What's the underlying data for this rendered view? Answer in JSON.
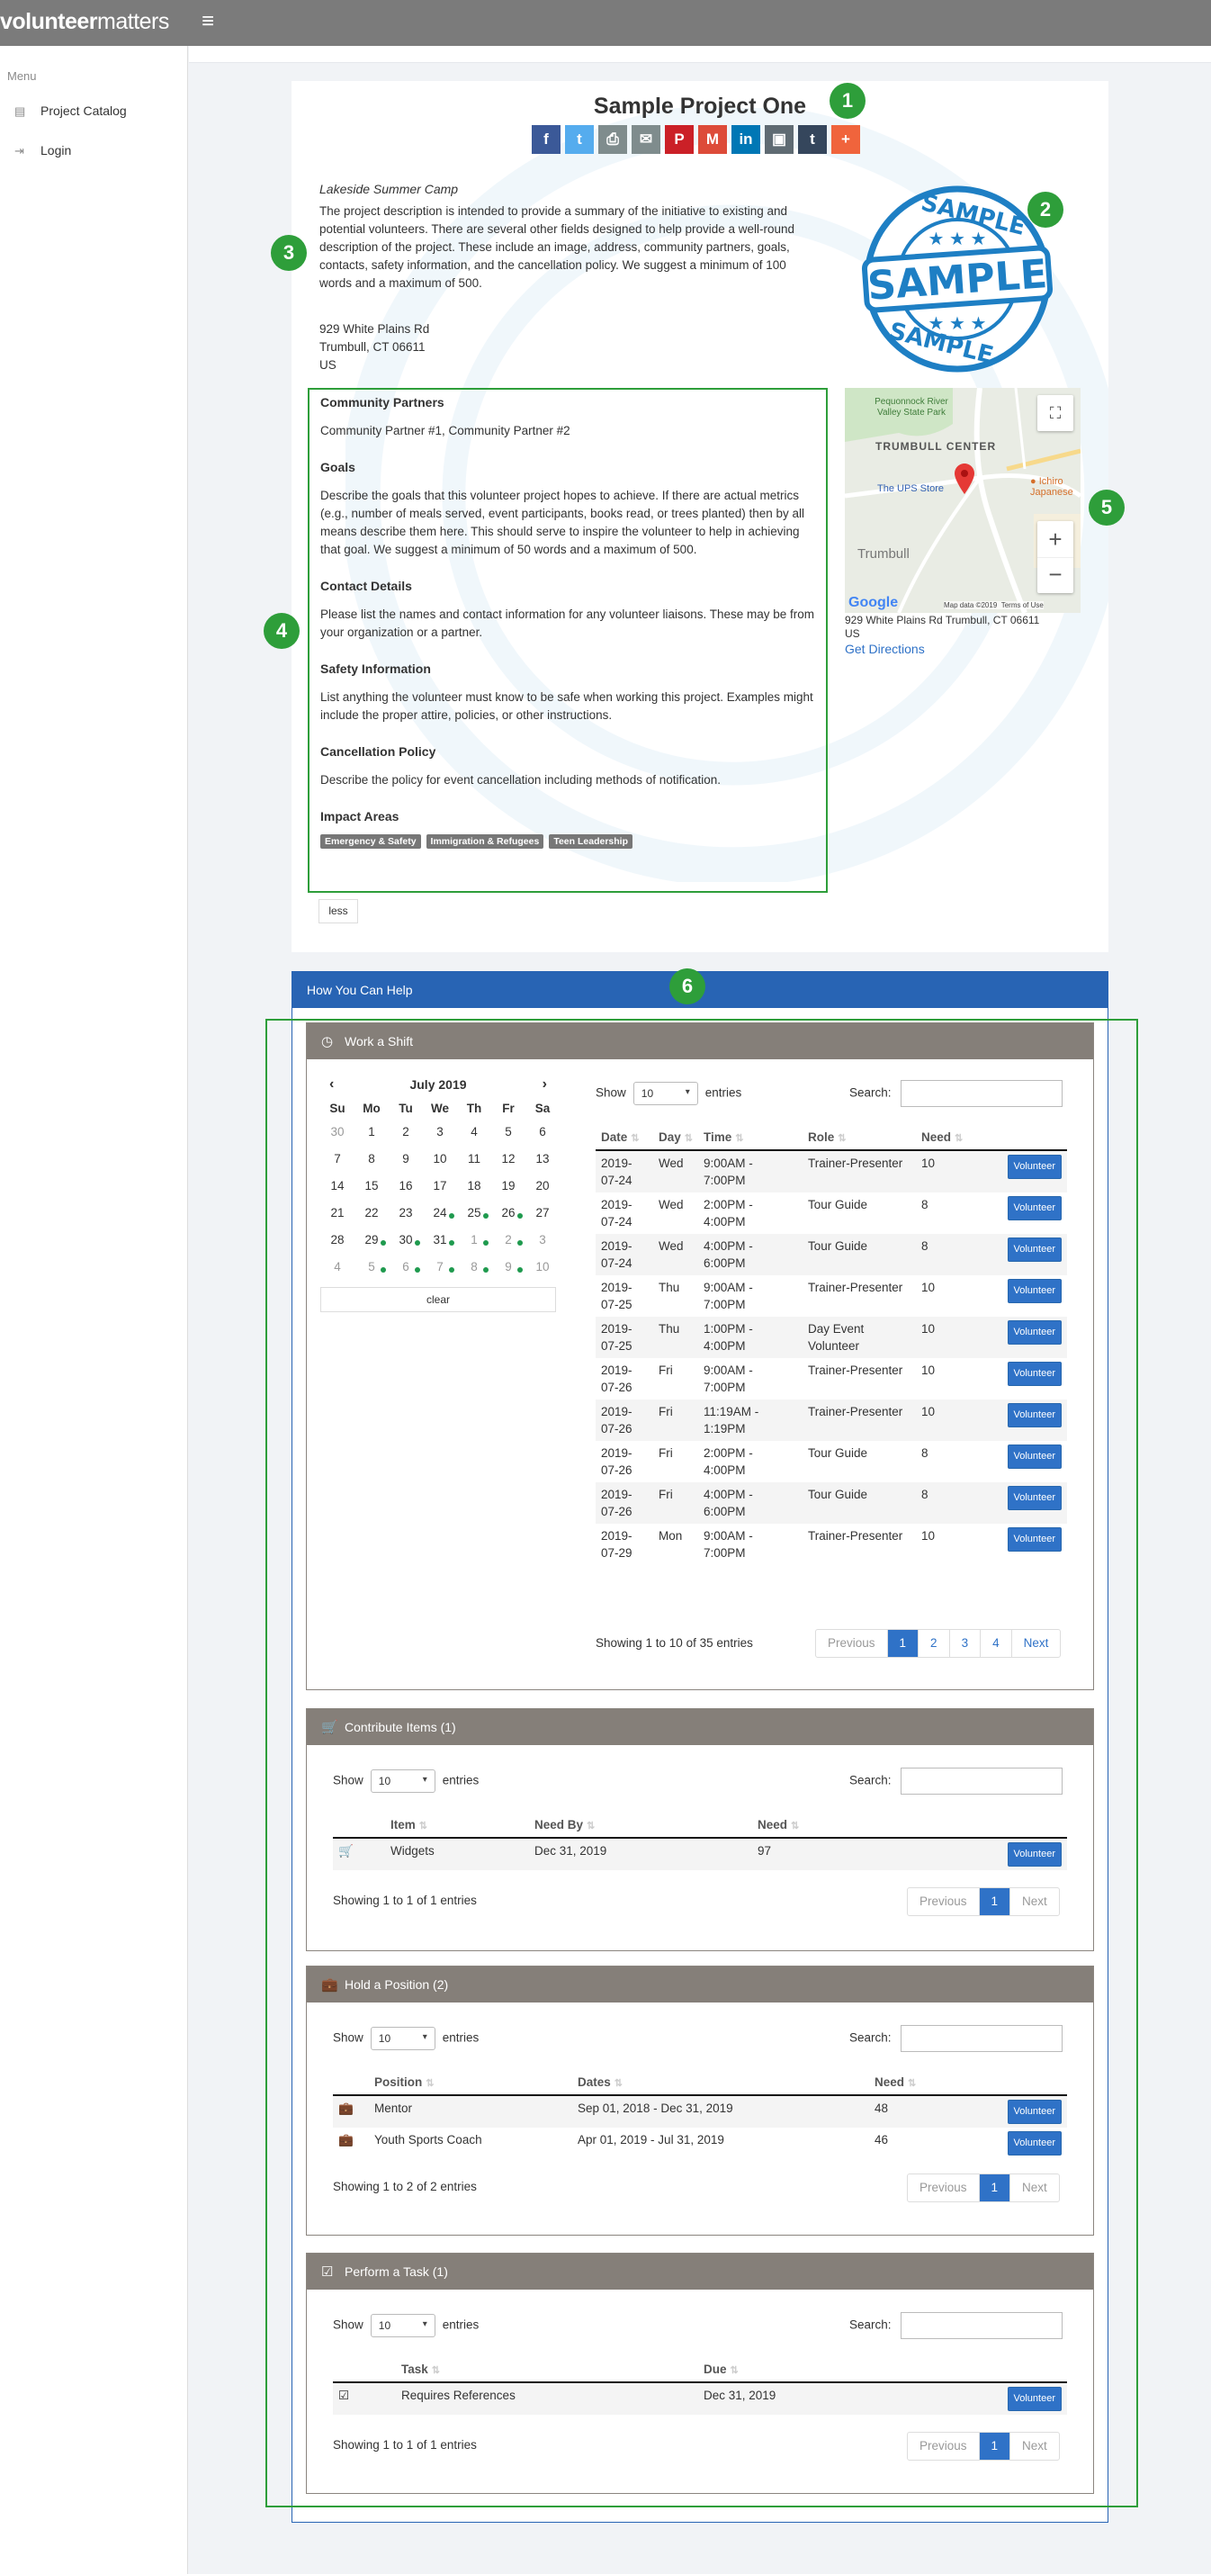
{
  "app": {
    "logo_part1": "volunteer",
    "logo_part2": "matters",
    "menu_icon": "hamburger-icon"
  },
  "sidebar": {
    "heading": "Menu",
    "items": [
      {
        "label": "Project Catalog",
        "icon": "catalog-icon"
      },
      {
        "label": "Login",
        "icon": "login-icon"
      }
    ]
  },
  "project": {
    "title": "Sample Project One",
    "share": [
      {
        "name": "facebook",
        "glyph": "f",
        "color": "#3b5998"
      },
      {
        "name": "twitter",
        "glyph": "t",
        "color": "#55acee"
      },
      {
        "name": "print",
        "glyph": "⎙",
        "color": "#7f8c8d"
      },
      {
        "name": "email",
        "glyph": "✉",
        "color": "#7f8c8d"
      },
      {
        "name": "pinterest",
        "glyph": "P",
        "color": "#cb2027"
      },
      {
        "name": "gmail",
        "glyph": "M",
        "color": "#dd4b39"
      },
      {
        "name": "linkedin",
        "glyph": "in",
        "color": "#0077b5"
      },
      {
        "name": "google-classroom",
        "glyph": "▣",
        "color": "#5f6b73"
      },
      {
        "name": "tumblr",
        "glyph": "t",
        "color": "#35465c"
      },
      {
        "name": "more",
        "glyph": "+",
        "color": "#f0643c"
      }
    ],
    "subtitle": "Lakeside Summer Camp",
    "description": "The project description is intended to provide a summary of the initiative to existing and potential volunteers. There are several other fields designed to help provide a well-round description of the project. These include an image, address, community partners, goals, contacts, safety information, and the cancellation policy. We suggest a minimum of 100 words and a maximum of 500.",
    "address": {
      "line1": "929 White Plains Rd",
      "line2": "Trumbull, CT 06611",
      "country": "US"
    },
    "stamp_text": "SAMPLE",
    "sections": [
      {
        "heading": "Community Partners",
        "body": "Community Partner #1, Community Partner #2"
      },
      {
        "heading": "Goals",
        "body": "Describe the goals that this volunteer project hopes to achieve. If there are actual metrics (e.g., number of meals served, event participants, books read, or trees planted) then by all means describe them here. This should serve to inspire the volunteer to help in achieving that goal. We suggest a minimum of 50 words and a maximum of 500."
      },
      {
        "heading": "Contact Details",
        "body": "Please list the names and contact information for any volunteer liaisons. These may be from your organization or a partner."
      },
      {
        "heading": "Safety Information",
        "body": "List anything the volunteer must know to be safe when working this project. Examples might include the proper attire, policies, or other instructions."
      },
      {
        "heading": "Cancellation Policy",
        "body": "Describe the policy for event cancellation including methods of notification."
      }
    ],
    "impact_heading": "Impact Areas",
    "impact_tags": [
      "Emergency & Safety",
      "Immigration & Refugees",
      "Teen Leadership"
    ],
    "less_label": "less",
    "map": {
      "labels": [
        "Pequonnock River Valley State Park",
        "TRUMBULL CENTER",
        "The UPS Store",
        "Ichiro Japanese",
        "Trumbull"
      ],
      "attribution": "Map data ©2019",
      "terms": "Terms of Use",
      "google": "Google",
      "address_line": "929 White Plains Rd Trumbull, CT 06611",
      "country": "US",
      "directions": "Get Directions"
    }
  },
  "callouts": [
    "1",
    "2",
    "3",
    "4",
    "5",
    "6"
  ],
  "help": {
    "heading": "How You Can Help"
  },
  "shifts": {
    "title": "Work a Shift",
    "calendar": {
      "month": "July 2019",
      "dow": [
        "Su",
        "Mo",
        "Tu",
        "We",
        "Th",
        "Fr",
        "Sa"
      ],
      "days": [
        [
          "30",
          "m",
          0
        ],
        [
          "1",
          "",
          0
        ],
        [
          "2",
          "",
          0
        ],
        [
          "3",
          "",
          0
        ],
        [
          "4",
          "",
          0
        ],
        [
          "5",
          "",
          0
        ],
        [
          "6",
          "",
          0
        ],
        [
          "7",
          "",
          0
        ],
        [
          "8",
          "",
          0
        ],
        [
          "9",
          "",
          0
        ],
        [
          "10",
          "",
          0
        ],
        [
          "11",
          "",
          0
        ],
        [
          "12",
          "",
          0
        ],
        [
          "13",
          "",
          0
        ],
        [
          "14",
          "",
          0
        ],
        [
          "15",
          "",
          0
        ],
        [
          "16",
          "",
          0
        ],
        [
          "17",
          "",
          0
        ],
        [
          "18",
          "",
          0
        ],
        [
          "19",
          "",
          0
        ],
        [
          "20",
          "",
          0
        ],
        [
          "21",
          "",
          0
        ],
        [
          "22",
          "",
          0
        ],
        [
          "23",
          "",
          0
        ],
        [
          "24",
          "",
          1
        ],
        [
          "25",
          "",
          1
        ],
        [
          "26",
          "",
          1
        ],
        [
          "27",
          "",
          0
        ],
        [
          "28",
          "",
          0
        ],
        [
          "29",
          "",
          1
        ],
        [
          "30",
          "",
          1
        ],
        [
          "31",
          "",
          1
        ],
        [
          "1",
          "m",
          1
        ],
        [
          "2",
          "m",
          1
        ],
        [
          "3",
          "m",
          0
        ],
        [
          "4",
          "m",
          0
        ],
        [
          "5",
          "m",
          1
        ],
        [
          "6",
          "m",
          1
        ],
        [
          "7",
          "m",
          1
        ],
        [
          "8",
          "m",
          1
        ],
        [
          "9",
          "m",
          1
        ],
        [
          "10",
          "m",
          0
        ]
      ],
      "clear_label": "clear"
    },
    "show": "Show",
    "entries_count": "10",
    "entries": "entries",
    "search": "Search:",
    "columns": [
      "Date",
      "Day",
      "Time",
      "Role",
      "Need"
    ],
    "rows": [
      [
        "2019-07-24",
        "Wed",
        "9:00AM - 7:00PM",
        "Trainer-Presenter",
        "10"
      ],
      [
        "2019-07-24",
        "Wed",
        "2:00PM - 4:00PM",
        "Tour Guide",
        "8"
      ],
      [
        "2019-07-24",
        "Wed",
        "4:00PM - 6:00PM",
        "Tour Guide",
        "8"
      ],
      [
        "2019-07-25",
        "Thu",
        "9:00AM - 7:00PM",
        "Trainer-Presenter",
        "10"
      ],
      [
        "2019-07-25",
        "Thu",
        "1:00PM - 4:00PM",
        "Day Event Volunteer",
        "10"
      ],
      [
        "2019-07-26",
        "Fri",
        "9:00AM - 7:00PM",
        "Trainer-Presenter",
        "10"
      ],
      [
        "2019-07-26",
        "Fri",
        "11:19AM - 1:19PM",
        "Trainer-Presenter",
        "10"
      ],
      [
        "2019-07-26",
        "Fri",
        "2:00PM - 4:00PM",
        "Tour Guide",
        "8"
      ],
      [
        "2019-07-26",
        "Fri",
        "4:00PM - 6:00PM",
        "Tour Guide",
        "8"
      ],
      [
        "2019-07-29",
        "Mon",
        "9:00AM - 7:00PM",
        "Trainer-Presenter",
        "10"
      ]
    ],
    "volunteer_label": "Volunteer",
    "info": "Showing 1 to 10 of 35 entries",
    "pager": [
      "Previous",
      "1",
      "2",
      "3",
      "4",
      "Next"
    ]
  },
  "contribute": {
    "title": "Contribute Items (1)",
    "show": "Show",
    "entries_count": "10",
    "entries": "entries",
    "search": "Search:",
    "columns": [
      "Item",
      "Need By",
      "Need"
    ],
    "rows": [
      [
        "Widgets",
        "Dec 31, 2019",
        "97"
      ]
    ],
    "volunteer_label": "Volunteer",
    "info": "Showing 1 to 1 of 1 entries",
    "pager": [
      "Previous",
      "1",
      "Next"
    ]
  },
  "positions": {
    "title": "Hold a Position (2)",
    "show": "Show",
    "entries_count": "10",
    "entries": "entries",
    "search": "Search:",
    "columns": [
      "Position",
      "Dates",
      "Need"
    ],
    "rows": [
      [
        "Mentor",
        "Sep 01, 2018 - Dec 31, 2019",
        "48"
      ],
      [
        "Youth Sports Coach",
        "Apr 01, 2019 - Jul 31, 2019",
        "46"
      ]
    ],
    "volunteer_label": "Volunteer",
    "info": "Showing 1 to 2 of 2 entries",
    "pager": [
      "Previous",
      "1",
      "Next"
    ]
  },
  "tasks": {
    "title": "Perform a Task (1)",
    "show": "Show",
    "entries_count": "10",
    "entries": "entries",
    "search": "Search:",
    "columns": [
      "Task",
      "Due"
    ],
    "rows": [
      [
        "Requires References",
        "Dec 31, 2019"
      ]
    ],
    "volunteer_label": "Volunteer",
    "info": "Showing 1 to 1 of 1 entries",
    "pager": [
      "Previous",
      "1",
      "Next"
    ]
  },
  "colors": {
    "brand_blue": "#2864b4",
    "section_header": "#857f79",
    "callout_green": "#2e9e3a",
    "stamp_blue": "#1e7fc4"
  }
}
